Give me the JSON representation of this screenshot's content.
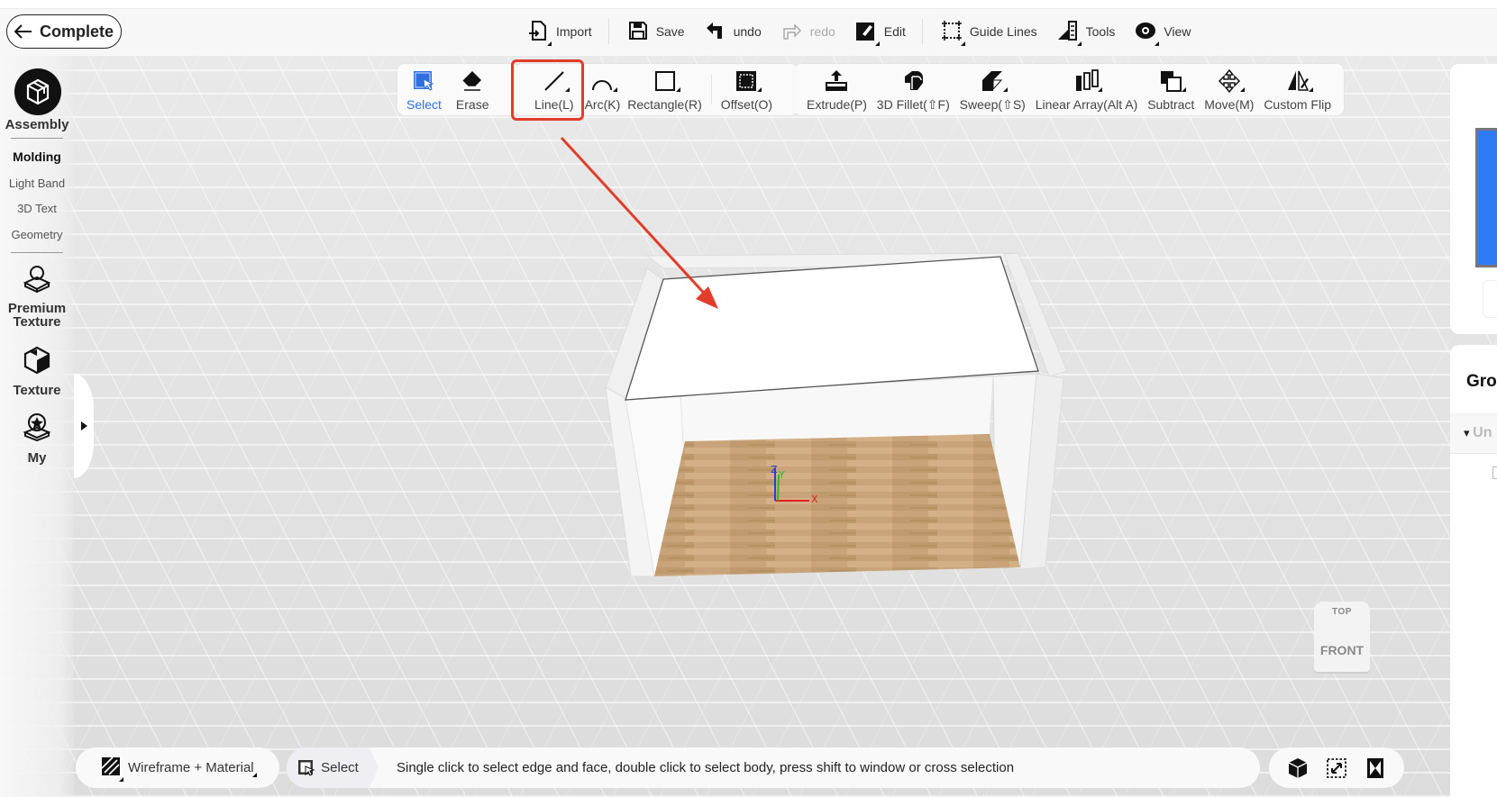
{
  "header": {
    "complete_label": "Complete",
    "menu": [
      {
        "label": "Import",
        "icon": "import-icon",
        "enabled": true
      },
      {
        "label": "Save",
        "icon": "save-icon",
        "enabled": true
      },
      {
        "label": "undo",
        "icon": "undo-icon",
        "enabled": true
      },
      {
        "label": "redo",
        "icon": "redo-icon",
        "enabled": false
      },
      {
        "label": "Edit",
        "icon": "edit-icon",
        "enabled": true
      },
      {
        "label": "Guide Lines",
        "icon": "guide-lines-icon",
        "enabled": true
      },
      {
        "label": "Tools",
        "icon": "tools-icon",
        "enabled": true
      },
      {
        "label": "View",
        "icon": "view-icon",
        "enabled": true
      }
    ]
  },
  "toolbar": {
    "select_group": [
      {
        "label": "Select",
        "icon": "select-icon",
        "active": true
      },
      {
        "label": "Erase",
        "icon": "eraser-icon",
        "active": false
      }
    ],
    "draw_group": [
      {
        "label": "Line(L)",
        "icon": "line-icon",
        "highlighted": true
      },
      {
        "label": "Arc(K)",
        "icon": "arc-icon"
      },
      {
        "label": "Rectangle(R)",
        "icon": "rectangle-icon"
      },
      {
        "label": "Offset(O)",
        "icon": "offset-icon"
      }
    ],
    "modify_group": [
      {
        "label": "Extrude(P)",
        "icon": "extrude-icon"
      },
      {
        "label": "3D Fillet(⇧F)",
        "icon": "fillet-icon"
      },
      {
        "label": "Sweep(⇧S)",
        "icon": "sweep-icon"
      },
      {
        "label": "Linear Array(Alt A)",
        "icon": "linear-array-icon"
      },
      {
        "label": "Subtract",
        "icon": "subtract-icon"
      },
      {
        "label": "Move(M)",
        "icon": "move-icon"
      },
      {
        "label": "Custom Flip",
        "icon": "custom-flip-icon"
      }
    ]
  },
  "sidebar": {
    "section_title": "Assembly",
    "links": [
      {
        "label": "Molding",
        "active": true
      },
      {
        "label": "Light Band",
        "active": false
      },
      {
        "label": "3D Text",
        "active": false
      },
      {
        "label": "Geometry",
        "active": false
      }
    ],
    "categories": [
      {
        "label": "Premium Texture",
        "icon": "premium-texture-icon"
      },
      {
        "label": "Texture",
        "icon": "texture-icon"
      },
      {
        "label": "My",
        "icon": "my-favorites-icon"
      }
    ]
  },
  "right_panel": {
    "swatch_color": "#2f7bf5",
    "group_title": "Gro",
    "group_row_label": "Un"
  },
  "view_cube": {
    "top": "TOP",
    "front": "FRONT"
  },
  "axes": {
    "x": "X",
    "y": "Y",
    "z": "Z"
  },
  "bottom_bar": {
    "render_mode": "Wireframe + Material",
    "current_tool": "Select",
    "hint": "Single click to select edge and face, double click to select body, press shift to window or cross selection"
  },
  "colors": {
    "accent": "#2f6fe0",
    "highlight": "#e23d2b"
  }
}
